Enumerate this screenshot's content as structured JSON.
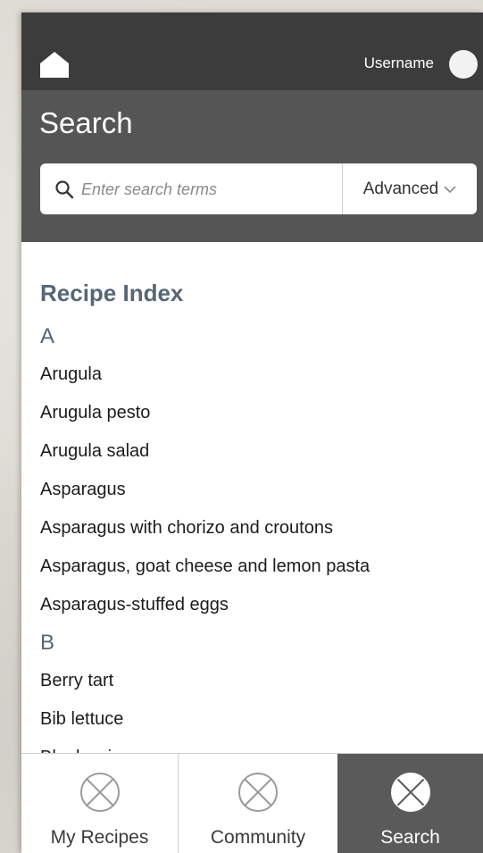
{
  "header": {
    "username": "Username"
  },
  "search": {
    "title": "Search",
    "placeholder": "Enter search terms",
    "advanced_label": "Advanced"
  },
  "index": {
    "title": "Recipe Index",
    "sections": [
      {
        "letter": "A",
        "items": [
          "Arugula",
          "Arugula pesto",
          "Arugula salad",
          "Asparagus",
          "Asparagus with chorizo and croutons",
          "Asparagus, goat cheese and lemon pasta",
          "Asparagus-stuffed eggs"
        ]
      },
      {
        "letter": "B",
        "items": [
          "Berry tart",
          "Bib lettuce",
          "Blueberries"
        ]
      }
    ]
  },
  "bottom_nav": {
    "tabs": [
      {
        "label": "My Recipes",
        "icon": "x-circle-icon",
        "active": false
      },
      {
        "label": "Community",
        "icon": "x-circle-icon",
        "active": false
      },
      {
        "label": "Search",
        "icon": "x-circle-icon",
        "active": true
      }
    ]
  },
  "colors": {
    "topbar": "#3c3c3c",
    "search_header": "#555555",
    "index_accent": "#566676",
    "active_tab": "#5a5a5a"
  }
}
